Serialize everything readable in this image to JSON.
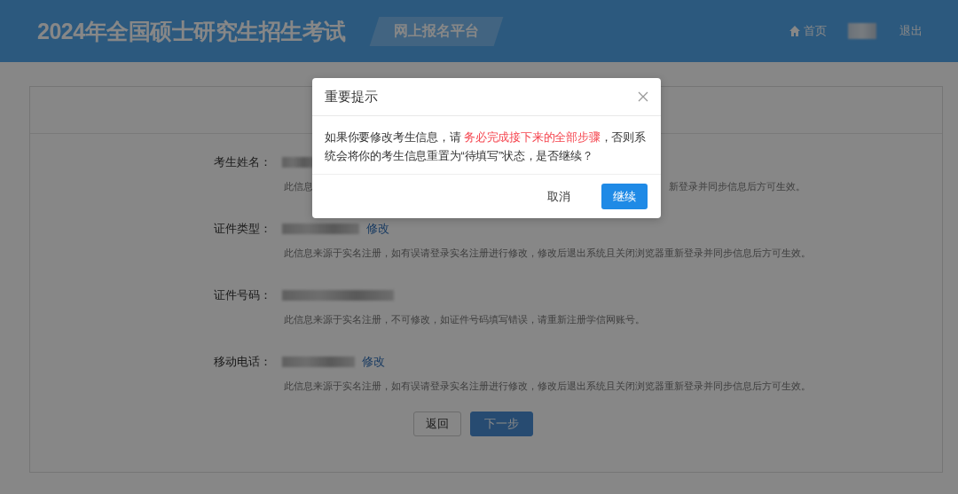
{
  "header": {
    "title": "2024年全国硕士研究生招生考试",
    "subtitle": "网上报名平台",
    "home": "首页",
    "logout": "退出"
  },
  "form": {
    "fields": [
      {
        "label": "考生姓名：",
        "note_parts": [
          "此信息",
          "新登录并同步信息后方可生效。"
        ]
      },
      {
        "label": "证件类型：",
        "action": "修改",
        "note": "此信息来源于实名注册，如有误请登录实名注册进行修改，修改后退出系统且关闭浏览器重新登录并同步信息后方可生效。"
      },
      {
        "label": "证件号码：",
        "note": "此信息来源于实名注册，不可修改，如证件号码填写错误，请重新注册学信网账号。"
      },
      {
        "label": "移动电话：",
        "action": "修改",
        "note": "此信息来源于实名注册，如有误请登录实名注册进行修改，修改后退出系统且关闭浏览器重新登录并同步信息后方可生效。"
      }
    ],
    "buttons": [
      {
        "label": "返回",
        "kind": "default"
      },
      {
        "label": "下一步",
        "kind": "primary"
      }
    ]
  },
  "dialog": {
    "title": "重要提示",
    "message": [
      {
        "text": "如果你要修改考生信息，请 ",
        "kind": "normal"
      },
      {
        "text": "务必完成接下来的全部步骤",
        "kind": "emphasis"
      },
      {
        "text": "，否则系统会将你的考生信息重置为“待填写”状态，是否继续？",
        "kind": "normal"
      }
    ],
    "buttons": [
      {
        "label": "取消",
        "kind": "default"
      },
      {
        "label": "继续",
        "kind": "primary"
      }
    ]
  }
}
